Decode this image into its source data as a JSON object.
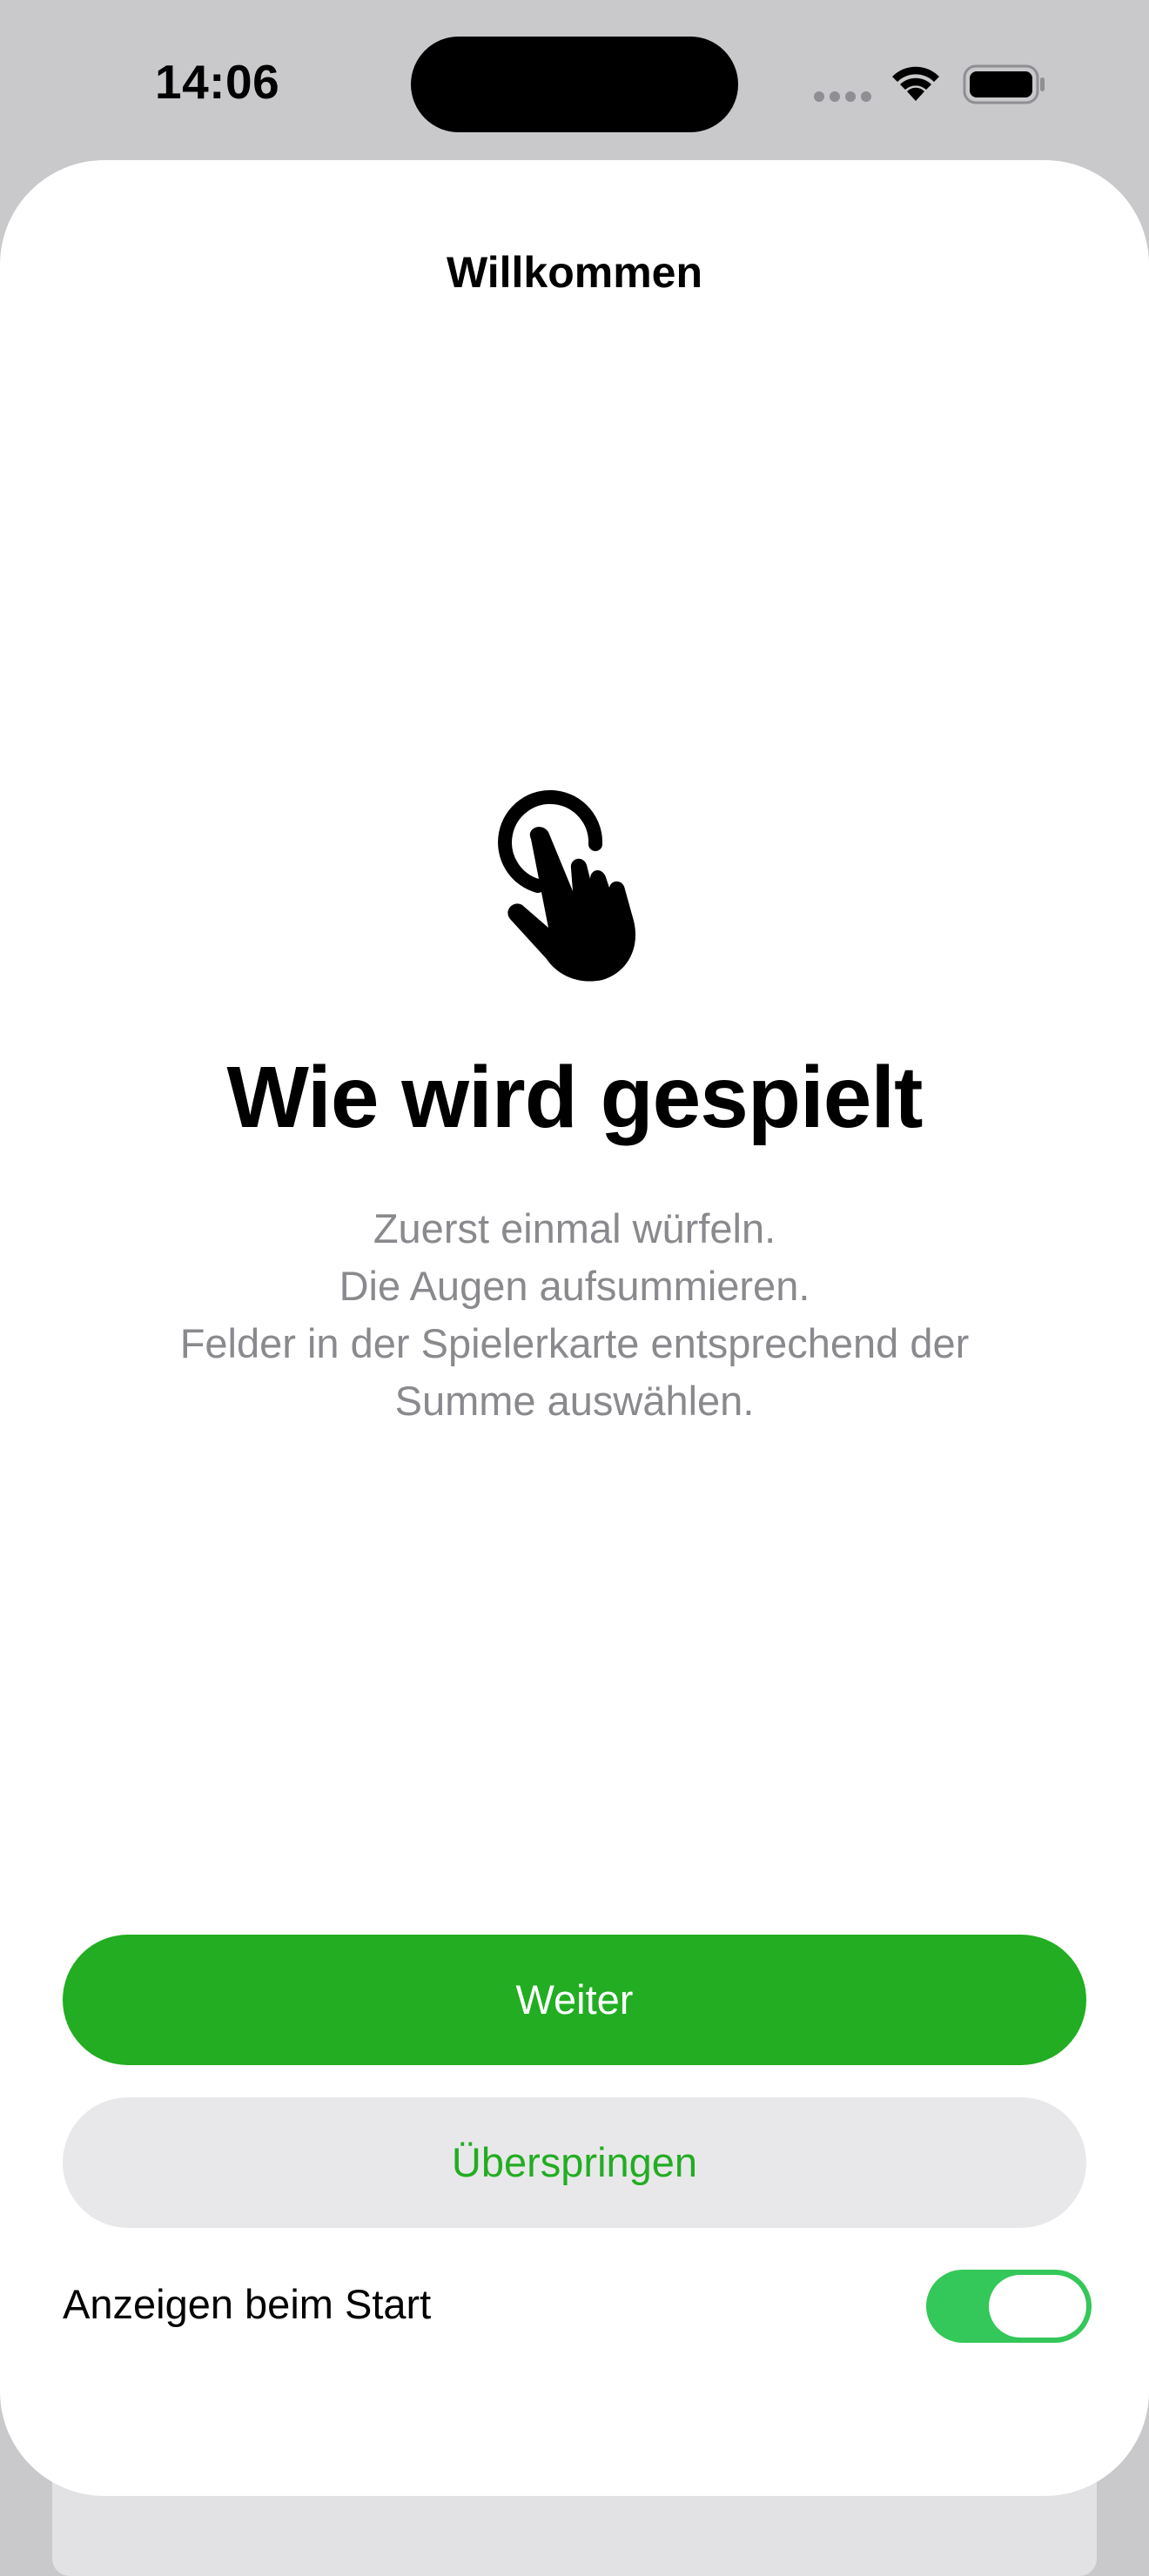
{
  "status_bar": {
    "time": "14:06"
  },
  "sheet": {
    "nav_title": "Willkommen",
    "icon": "hand-tap-icon",
    "headline": "Wie wird gespielt",
    "description_lines": [
      "Zuerst einmal würfeln.",
      "Die Augen aufsummieren.",
      "Felder in der Spielerkarte entsprechend der",
      "Summe auswählen."
    ],
    "primary_button": "Weiter",
    "secondary_button": "Überspringen",
    "toggle": {
      "label": "Anzeigen beim Start",
      "on": true
    }
  },
  "colors": {
    "accent": "#22ad22",
    "toggle_on": "#34c759",
    "secondary_bg": "#e8e8ea",
    "description_text": "#8a8a8e"
  }
}
